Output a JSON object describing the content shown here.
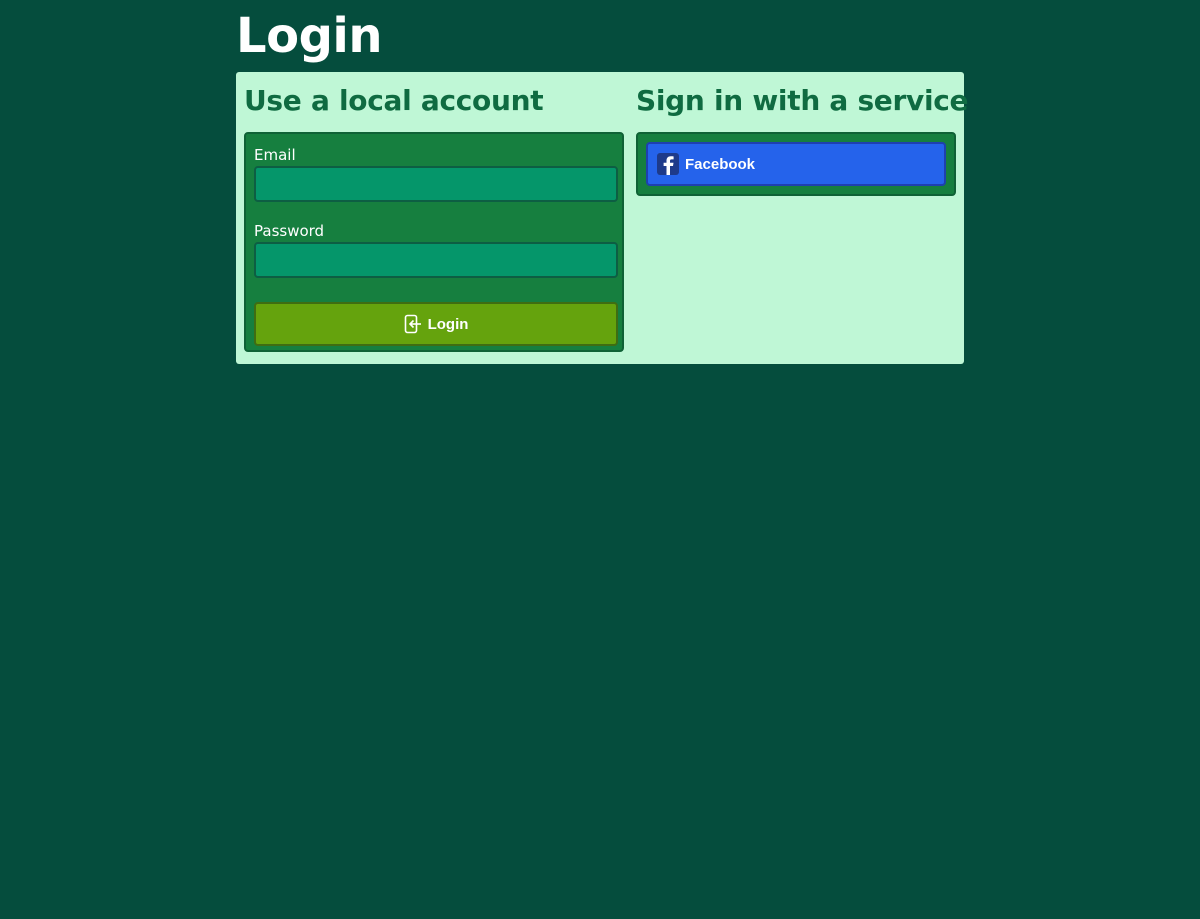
{
  "page": {
    "title": "Login"
  },
  "local_account": {
    "heading": "Use a local account",
    "email_label": "Email",
    "email_value": "",
    "email_placeholder": "",
    "password_label": "Password",
    "password_value": "",
    "password_placeholder": "",
    "login_button_label": "Login",
    "login_icon": "login-icon"
  },
  "services": {
    "heading": "Sign in with a service",
    "providers": [
      {
        "label": "Facebook",
        "icon": "facebook-icon"
      }
    ]
  },
  "colors": {
    "background": "#054d3d",
    "panel": "#bff7d6",
    "box": "#167f3f",
    "input": "#05966a",
    "login_button": "#65a30d",
    "facebook_button": "#2563eb"
  }
}
